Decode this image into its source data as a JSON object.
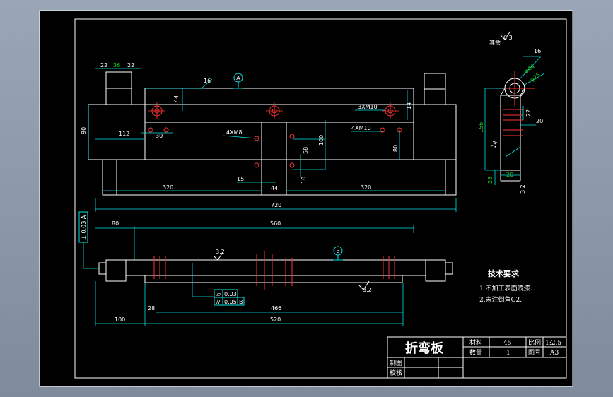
{
  "drawing": {
    "colors": {
      "background": "#000000",
      "outline": "#ffffff",
      "dimension": "#00e5e5",
      "center": "#ff2222",
      "accent": "#22cc22",
      "frame_outer": "#9aa6b6"
    },
    "front_view": {
      "dims": {
        "d22a": "22",
        "d36": "36",
        "d22b": "22",
        "d16": "16",
        "d44": "44",
        "d3xm10": "3XM10",
        "d14": "14",
        "d90": "90",
        "d112": "112",
        "d30": "30",
        "d4xm8": "4XM8",
        "d4xm10": "4XM10",
        "d58": "58",
        "d100": "100",
        "d80": "80",
        "d15": "15",
        "d10": "10",
        "d44b": "44",
        "d320a": "320",
        "d320b": "320",
        "d720": "720"
      },
      "datum_a": "A"
    },
    "top_view": {
      "dims": {
        "d80": "80",
        "d560": "560",
        "d32a": "3.2",
        "d32b": "3.2",
        "d28": "28",
        "d466": "466",
        "d100": "100",
        "d520": "520"
      },
      "datum_b": "B",
      "tol_perp": "⊥ 0.03 A",
      "tol_flat": "0.03",
      "tol_par": "0.05",
      "tol_par_ref": "B"
    },
    "side_view": {
      "dims": {
        "d63": "6.3",
        "d16": "16",
        "d44": "φ44",
        "d25": "φ25",
        "d22": "22",
        "d20a": "20",
        "d156": "156",
        "d14": "14",
        "d20b": "20",
        "d25b": "25",
        "d32": "3.2"
      },
      "label_rest": "其余"
    },
    "notes": {
      "title": "技术要求",
      "line1": "1.不加工表面喷漆.",
      "line2": "2.未注倒角C2."
    },
    "title_block": {
      "part_name": "折弯板",
      "material_label": "材料",
      "material_value": "45",
      "ratio_label": "比例",
      "ratio_value": "1:2.5",
      "qty_label": "数量",
      "qty_value": "1",
      "dwg_label": "图号",
      "dwg_value": "A3",
      "drawn_label": "制图",
      "check_label": "校核"
    }
  }
}
